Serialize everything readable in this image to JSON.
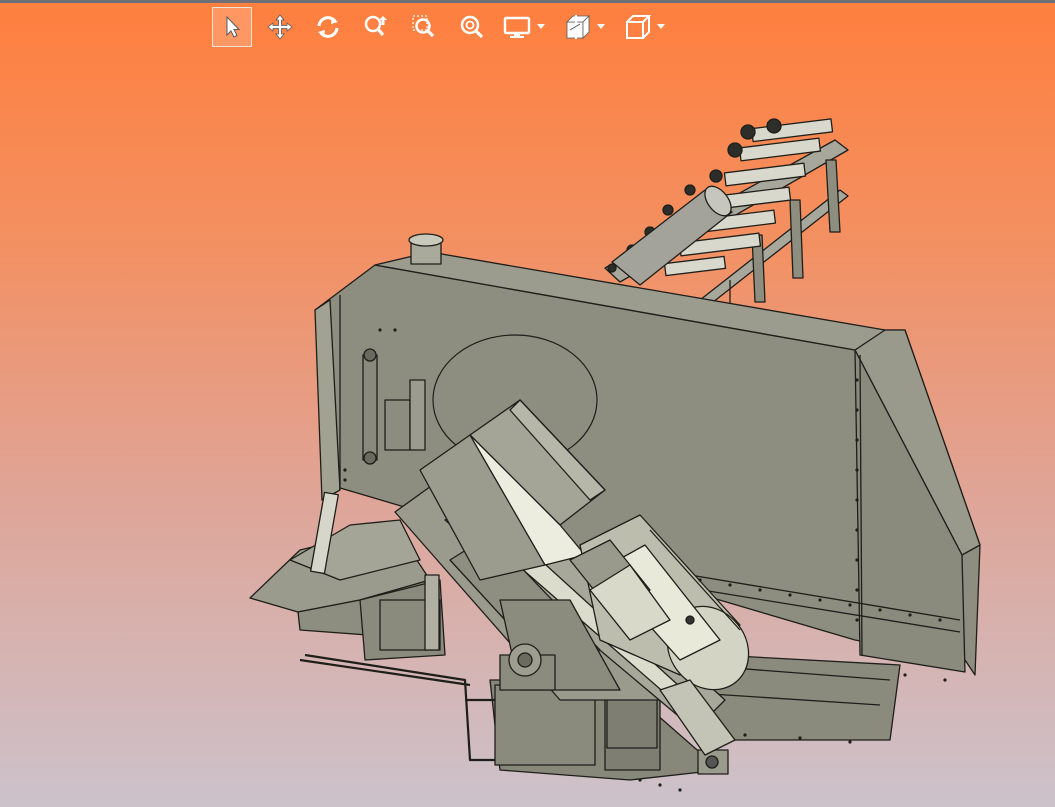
{
  "toolbar": {
    "tools": [
      {
        "icon": "select-arrow-icon",
        "active": true
      },
      {
        "icon": "pan-icon",
        "active": false
      },
      {
        "icon": "rotate-icon",
        "active": false
      },
      {
        "icon": "zoom-in-out-icon",
        "active": false
      },
      {
        "icon": "zoom-window-icon",
        "active": false
      },
      {
        "icon": "zoom-fit-icon",
        "active": false
      },
      {
        "icon": "display-mode-icon",
        "dropdown": true
      },
      {
        "icon": "section-view-icon",
        "dropdown": true
      },
      {
        "icon": "view-cube-icon",
        "dropdown": true
      }
    ]
  },
  "colors": {
    "background_top": "#ff7f3e",
    "background_bottom": "#ccc2cb",
    "model_body": "#8e8e80",
    "model_light": "#ecebdc",
    "model_edge": "#1e1e1a"
  }
}
